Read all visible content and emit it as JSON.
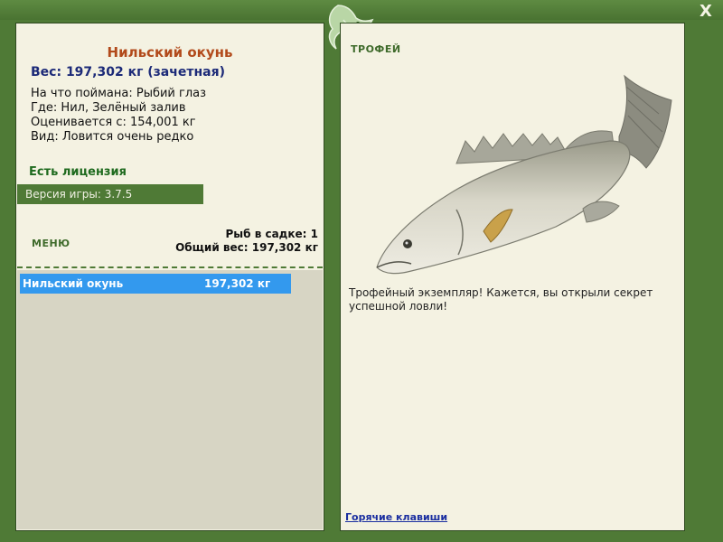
{
  "window": {
    "close_label": "X"
  },
  "fish": {
    "name": "Нильский окунь",
    "weight_line": "Вес: 197,302 кг (зачетная)",
    "bait": "На что поймана: Рыбий глаз",
    "place": "Где: Нил, Зелёный залив",
    "value": "Оценивается с: 154,001 кг",
    "rarity": "Вид: Ловится очень редко"
  },
  "license": "Есть лицензия",
  "version": "Версия игры: 3.7.5",
  "menu_label": "МЕНЮ",
  "cage": {
    "count": "Рыб в садке: 1",
    "total": "Общий вес: 197,302 кг",
    "items": [
      {
        "name": "Нильский окунь",
        "weight": "197,302 кг"
      }
    ]
  },
  "trophy": {
    "label": "ТРОФЕЙ",
    "text": "Трофейный экземпляр! Кажется, вы открыли секрет успешной ловли!"
  },
  "hotkeys": "Горячие клавиши"
}
